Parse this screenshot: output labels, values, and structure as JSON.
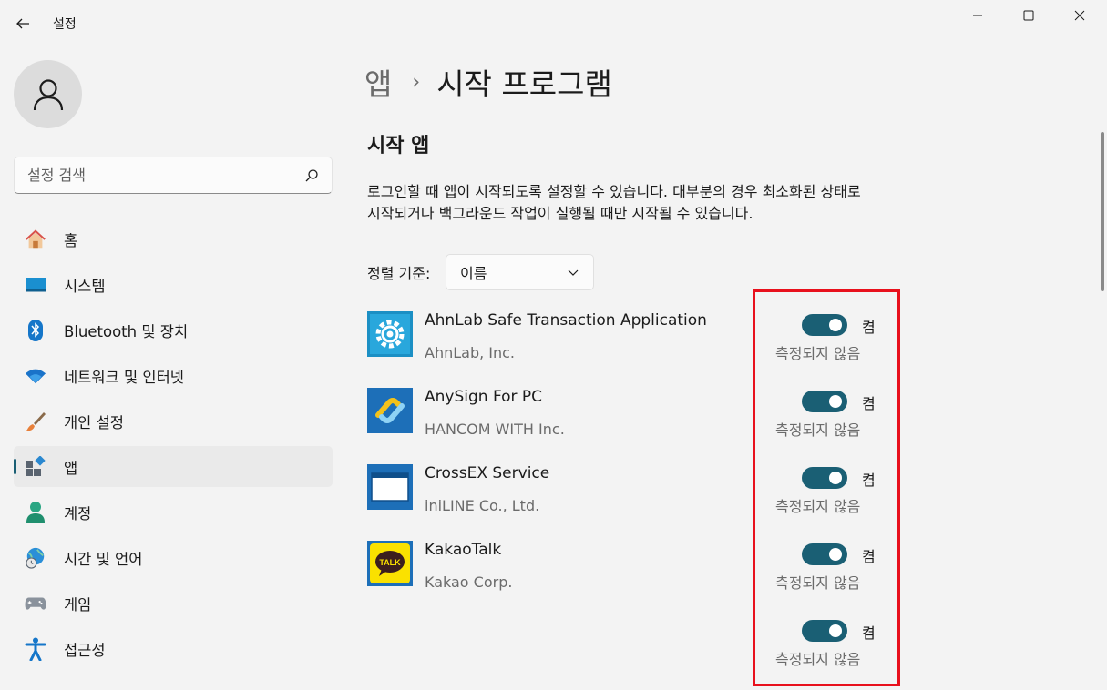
{
  "window": {
    "title": "설정"
  },
  "search": {
    "placeholder": "설정 검색"
  },
  "sidebar": {
    "items": [
      {
        "label": "홈",
        "icon": "home-icon"
      },
      {
        "label": "시스템",
        "icon": "system-icon"
      },
      {
        "label": "Bluetooth 및 장치",
        "icon": "bluetooth-icon"
      },
      {
        "label": "네트워크 및 인터넷",
        "icon": "wifi-icon"
      },
      {
        "label": "개인 설정",
        "icon": "brush-icon"
      },
      {
        "label": "앱",
        "icon": "apps-icon",
        "active": true
      },
      {
        "label": "계정",
        "icon": "account-icon"
      },
      {
        "label": "시간 및 언어",
        "icon": "globe-clock-icon"
      },
      {
        "label": "게임",
        "icon": "gamepad-icon"
      },
      {
        "label": "접근성",
        "icon": "accessibility-icon"
      }
    ]
  },
  "breadcrumb": {
    "parent": "앱",
    "separator": "›",
    "current": "시작 프로그램"
  },
  "section": {
    "title": "시작 앱",
    "description": "로그인할 때 앱이 시작되도록 설정할 수 있습니다. 대부분의 경우 최소화된 상태로 시작되거나 백그라운드 작업이 실행될 때만 시작될 수 있습니다."
  },
  "sort": {
    "label": "정렬 기준:",
    "selected": "이름"
  },
  "apps": [
    {
      "name": "AhnLab Safe Transaction Application",
      "publisher": "AhnLab, Inc.",
      "state": "켬",
      "impact": "측정되지 않음",
      "on": true
    },
    {
      "name": "AnySign For PC",
      "publisher": "HANCOM WITH Inc.",
      "state": "켬",
      "impact": "측정되지 않음",
      "on": true
    },
    {
      "name": "CrossEX Service",
      "publisher": "iniLINE Co., Ltd.",
      "state": "켬",
      "impact": "측정되지 않음",
      "on": true
    },
    {
      "name": "KakaoTalk",
      "publisher": "Kakao Corp.",
      "state": "켬",
      "impact": "측정되지 않음",
      "on": true
    },
    {
      "name": "",
      "publisher": "",
      "state": "켬",
      "impact": "측정되지 않음",
      "on": true
    }
  ],
  "kakao_icon_text": "TALK",
  "colors": {
    "accent": "#1a5f74",
    "highlight": "#e8101c",
    "background": "#f3f3f3"
  }
}
